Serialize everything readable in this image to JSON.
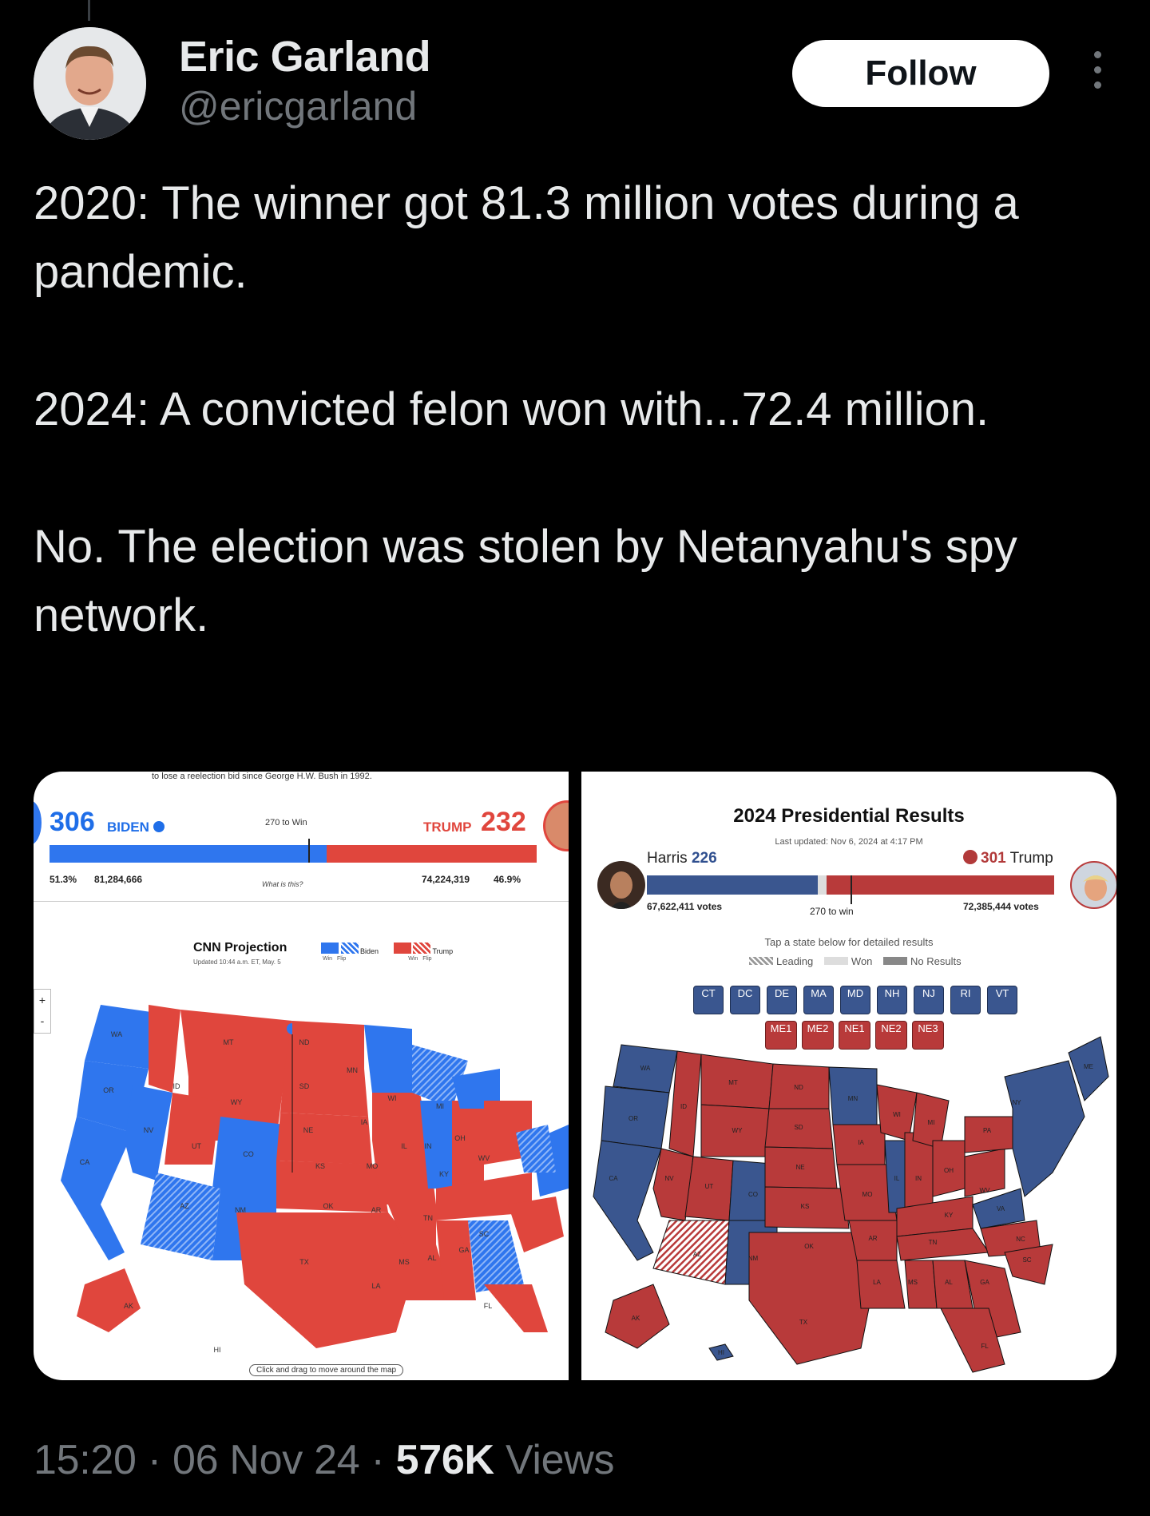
{
  "author": {
    "name": "Eric Garland",
    "handle": "@ericgarland",
    "follow_label": "Follow"
  },
  "tweet": {
    "paragraphs": [
      "2020: The winner got 81.3 million votes during a pandemic.",
      "2024: A convicted felon won with...72.4 million.",
      "No. The election was stolen by Netanyahu's spy network."
    ]
  },
  "images": {
    "left": {
      "caption_top": "to lose a reelection bid since George H.W. Bush in 1992.",
      "biden_ev": "306",
      "biden_label": "BIDEN",
      "trump_label": "TRUMP",
      "trump_ev": "232",
      "win_label": "270 to Win",
      "biden_pct": "51.3%",
      "biden_votes": "81,284,666",
      "trump_votes": "74,224,319",
      "trump_pct": "46.9%",
      "what_is_this": "What is this?",
      "projection": "CNN Projection",
      "updated": "Updated 10:44 a.m. ET, May. 5",
      "legend_biden": "Biden",
      "legend_trump": "Trump",
      "legend_win": "Win",
      "legend_flip": "Flip",
      "hint": "Click and drag to move around the map",
      "zoom_in": "+",
      "zoom_out": "-",
      "colors": {
        "dem": "#2f76ee",
        "rep": "#e0463d"
      }
    },
    "right": {
      "title": "2024 Presidential Results",
      "updated": "Last updated: Nov 6, 2024 at 4:17 PM",
      "harris_label": "Harris",
      "harris_ev": "226",
      "trump_ev": "301",
      "trump_label": "Trump",
      "harris_votes": "67,622,411 votes",
      "trump_votes": "72,385,444 votes",
      "win_label": "270 to win",
      "tap_hint": "Tap a state below for detailed results",
      "legend": [
        "Leading",
        "Won",
        "No Results"
      ],
      "chips_row1": [
        "CT",
        "DC",
        "DE",
        "MA",
        "MD",
        "NH",
        "NJ",
        "RI",
        "VT"
      ],
      "chips_row2": [
        "ME1",
        "ME2",
        "NE1",
        "NE2",
        "NE3"
      ],
      "colors": {
        "dem": "#3a568f",
        "rep": "#b83a3a"
      }
    }
  },
  "footer": {
    "time": "15:20",
    "date": "06 Nov 24",
    "views_count": "576K",
    "views_label": "Views"
  }
}
